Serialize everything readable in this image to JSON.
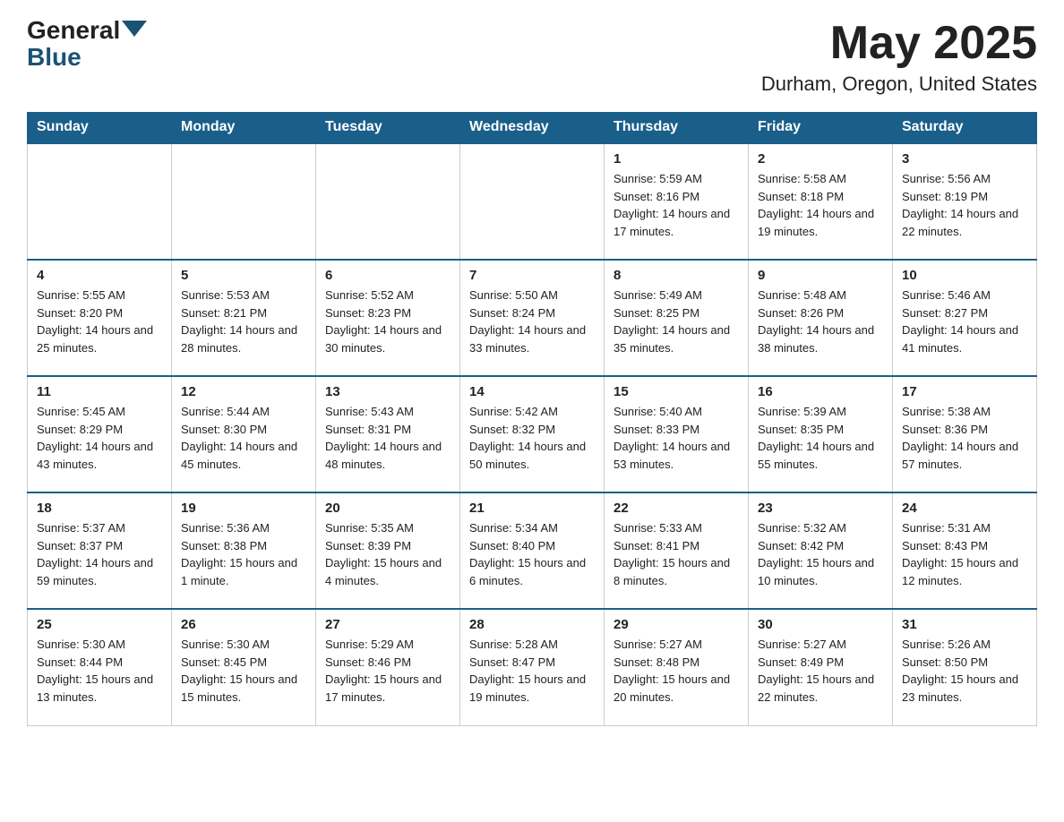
{
  "header": {
    "logo_general": "General",
    "logo_blue": "Blue",
    "month_year": "May 2025",
    "location": "Durham, Oregon, United States"
  },
  "days_of_week": [
    "Sunday",
    "Monday",
    "Tuesday",
    "Wednesday",
    "Thursday",
    "Friday",
    "Saturday"
  ],
  "weeks": [
    [
      {
        "day": "",
        "info": ""
      },
      {
        "day": "",
        "info": ""
      },
      {
        "day": "",
        "info": ""
      },
      {
        "day": "",
        "info": ""
      },
      {
        "day": "1",
        "info": "Sunrise: 5:59 AM\nSunset: 8:16 PM\nDaylight: 14 hours and 17 minutes."
      },
      {
        "day": "2",
        "info": "Sunrise: 5:58 AM\nSunset: 8:18 PM\nDaylight: 14 hours and 19 minutes."
      },
      {
        "day": "3",
        "info": "Sunrise: 5:56 AM\nSunset: 8:19 PM\nDaylight: 14 hours and 22 minutes."
      }
    ],
    [
      {
        "day": "4",
        "info": "Sunrise: 5:55 AM\nSunset: 8:20 PM\nDaylight: 14 hours and 25 minutes."
      },
      {
        "day": "5",
        "info": "Sunrise: 5:53 AM\nSunset: 8:21 PM\nDaylight: 14 hours and 28 minutes."
      },
      {
        "day": "6",
        "info": "Sunrise: 5:52 AM\nSunset: 8:23 PM\nDaylight: 14 hours and 30 minutes."
      },
      {
        "day": "7",
        "info": "Sunrise: 5:50 AM\nSunset: 8:24 PM\nDaylight: 14 hours and 33 minutes."
      },
      {
        "day": "8",
        "info": "Sunrise: 5:49 AM\nSunset: 8:25 PM\nDaylight: 14 hours and 35 minutes."
      },
      {
        "day": "9",
        "info": "Sunrise: 5:48 AM\nSunset: 8:26 PM\nDaylight: 14 hours and 38 minutes."
      },
      {
        "day": "10",
        "info": "Sunrise: 5:46 AM\nSunset: 8:27 PM\nDaylight: 14 hours and 41 minutes."
      }
    ],
    [
      {
        "day": "11",
        "info": "Sunrise: 5:45 AM\nSunset: 8:29 PM\nDaylight: 14 hours and 43 minutes."
      },
      {
        "day": "12",
        "info": "Sunrise: 5:44 AM\nSunset: 8:30 PM\nDaylight: 14 hours and 45 minutes."
      },
      {
        "day": "13",
        "info": "Sunrise: 5:43 AM\nSunset: 8:31 PM\nDaylight: 14 hours and 48 minutes."
      },
      {
        "day": "14",
        "info": "Sunrise: 5:42 AM\nSunset: 8:32 PM\nDaylight: 14 hours and 50 minutes."
      },
      {
        "day": "15",
        "info": "Sunrise: 5:40 AM\nSunset: 8:33 PM\nDaylight: 14 hours and 53 minutes."
      },
      {
        "day": "16",
        "info": "Sunrise: 5:39 AM\nSunset: 8:35 PM\nDaylight: 14 hours and 55 minutes."
      },
      {
        "day": "17",
        "info": "Sunrise: 5:38 AM\nSunset: 8:36 PM\nDaylight: 14 hours and 57 minutes."
      }
    ],
    [
      {
        "day": "18",
        "info": "Sunrise: 5:37 AM\nSunset: 8:37 PM\nDaylight: 14 hours and 59 minutes."
      },
      {
        "day": "19",
        "info": "Sunrise: 5:36 AM\nSunset: 8:38 PM\nDaylight: 15 hours and 1 minute."
      },
      {
        "day": "20",
        "info": "Sunrise: 5:35 AM\nSunset: 8:39 PM\nDaylight: 15 hours and 4 minutes."
      },
      {
        "day": "21",
        "info": "Sunrise: 5:34 AM\nSunset: 8:40 PM\nDaylight: 15 hours and 6 minutes."
      },
      {
        "day": "22",
        "info": "Sunrise: 5:33 AM\nSunset: 8:41 PM\nDaylight: 15 hours and 8 minutes."
      },
      {
        "day": "23",
        "info": "Sunrise: 5:32 AM\nSunset: 8:42 PM\nDaylight: 15 hours and 10 minutes."
      },
      {
        "day": "24",
        "info": "Sunrise: 5:31 AM\nSunset: 8:43 PM\nDaylight: 15 hours and 12 minutes."
      }
    ],
    [
      {
        "day": "25",
        "info": "Sunrise: 5:30 AM\nSunset: 8:44 PM\nDaylight: 15 hours and 13 minutes."
      },
      {
        "day": "26",
        "info": "Sunrise: 5:30 AM\nSunset: 8:45 PM\nDaylight: 15 hours and 15 minutes."
      },
      {
        "day": "27",
        "info": "Sunrise: 5:29 AM\nSunset: 8:46 PM\nDaylight: 15 hours and 17 minutes."
      },
      {
        "day": "28",
        "info": "Sunrise: 5:28 AM\nSunset: 8:47 PM\nDaylight: 15 hours and 19 minutes."
      },
      {
        "day": "29",
        "info": "Sunrise: 5:27 AM\nSunset: 8:48 PM\nDaylight: 15 hours and 20 minutes."
      },
      {
        "day": "30",
        "info": "Sunrise: 5:27 AM\nSunset: 8:49 PM\nDaylight: 15 hours and 22 minutes."
      },
      {
        "day": "31",
        "info": "Sunrise: 5:26 AM\nSunset: 8:50 PM\nDaylight: 15 hours and 23 minutes."
      }
    ]
  ]
}
